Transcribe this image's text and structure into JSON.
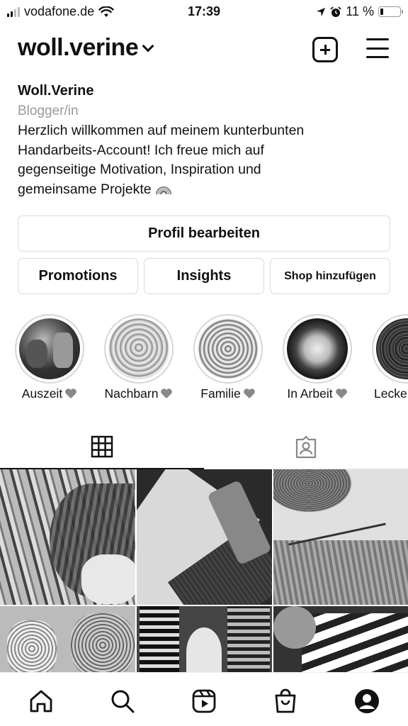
{
  "status_bar": {
    "carrier": "vodafone.de",
    "time": "17:39",
    "battery": "11 %",
    "battery_level": 0.11
  },
  "header": {
    "username": "woll.verine",
    "icons": [
      "chevron-down-icon",
      "new-post-icon",
      "menu-icon"
    ]
  },
  "profile": {
    "name": "Woll.Verine",
    "category": "Blogger/in",
    "bio_lines": [
      "Herzlich willkommen auf meinem kunterbunten",
      "Handarbeits-Account! Ich freue mich auf",
      "gegenseitige Motivation, Inspiration und",
      "gemeinsame Projekte"
    ],
    "bio_emoji": "rainbow-icon"
  },
  "buttons": {
    "edit_profile": "Profil bearbeiten",
    "promotions": "Promotions",
    "insights": "Insights",
    "add_shop": "Shop hinzufügen"
  },
  "highlights": [
    {
      "label": "Auszeit",
      "emoji": "heart-icon"
    },
    {
      "label": "Nachbarn",
      "emoji": "heart-icon"
    },
    {
      "label": "Familie",
      "emoji": "heart-icon"
    },
    {
      "label": "In Arbeit",
      "emoji": "heart-icon"
    },
    {
      "label": "Lecke",
      "emoji": ""
    }
  ],
  "tabs": [
    {
      "name": "grid",
      "icon": "grid-icon",
      "active": true
    },
    {
      "name": "tagged",
      "icon": "tagged-icon",
      "active": false
    }
  ],
  "bottom_nav": [
    "home-icon",
    "search-icon",
    "reels-icon",
    "shop-icon",
    "profile-icon"
  ],
  "colors": {
    "text": "#111111",
    "secondary_text": "#9a9a9a",
    "border": "#dbdbdb",
    "heart": "#888888"
  }
}
